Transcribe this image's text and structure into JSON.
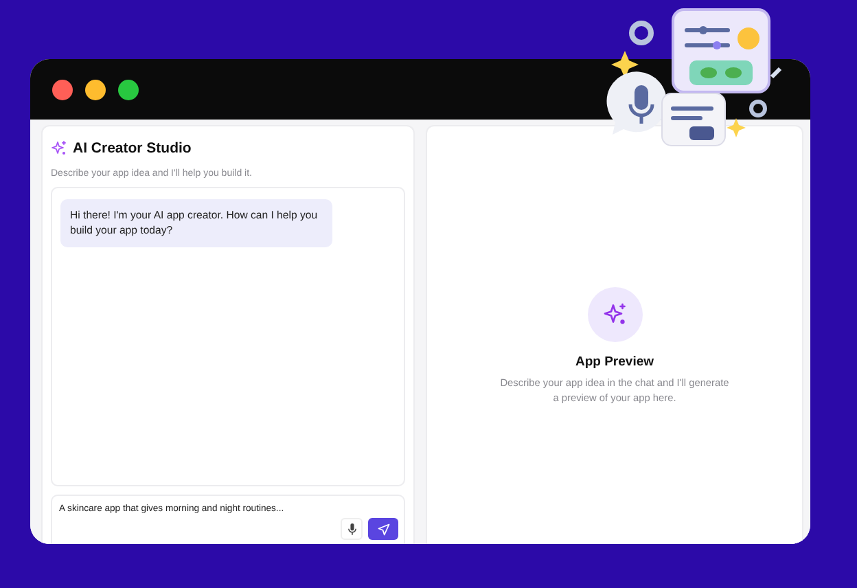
{
  "window": {
    "controls": [
      {
        "color": "#ff5f57"
      },
      {
        "color": "#febc2e"
      },
      {
        "color": "#28c840"
      }
    ]
  },
  "chat_panel": {
    "title": "AI Creator Studio",
    "subtitle": "Describe your app idea and I'll help you build it.",
    "messages": [
      {
        "text": "Hi there! I'm your AI app creator. How can I help you build your app today?"
      }
    ],
    "input": {
      "value": "A skincare app that gives morning and night routines..."
    }
  },
  "preview_panel": {
    "title": "App Preview",
    "description": "Describe your app idea in the chat and I'll generate a preview of your app here."
  }
}
